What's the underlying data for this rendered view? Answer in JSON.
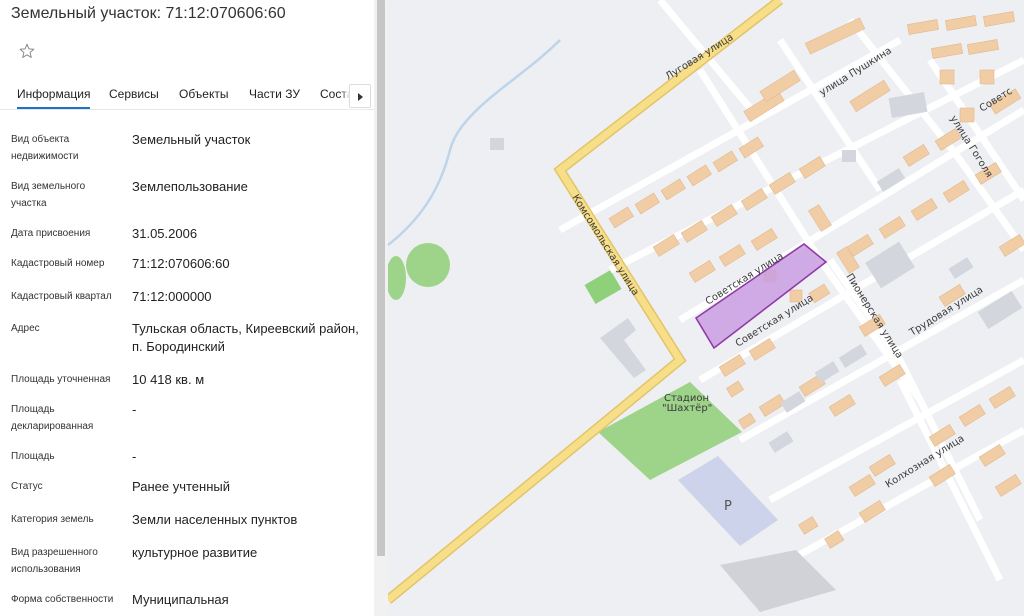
{
  "title": "Земельный участок: 71:12:070606:60",
  "tabs": [
    {
      "label": "Информация",
      "active": true
    },
    {
      "label": "Сервисы"
    },
    {
      "label": "Объекты"
    },
    {
      "label": "Части ЗУ"
    },
    {
      "label": "Состав"
    }
  ],
  "fields": [
    {
      "label": "Вид объекта недвижимости",
      "value": "Земельный участок"
    },
    {
      "label": "Вид земельного участка",
      "value": "Землепользование"
    },
    {
      "label": "Дата присвоения",
      "value": "31.05.2006"
    },
    {
      "label": "Кадастровый номер",
      "value": "71:12:070606:60"
    },
    {
      "label": "Кадастровый квартал",
      "value": "71:12:000000"
    },
    {
      "label": "Адрес",
      "value": "Тульская область, Киреевский район, п. Бородинский"
    },
    {
      "label": "Площадь уточненная",
      "value": "10 418 кв. м"
    },
    {
      "label": "Площадь декларированная",
      "value": "-"
    },
    {
      "label": "Площадь",
      "value": "-"
    },
    {
      "label": "Статус",
      "value": "Ранее учтенный"
    },
    {
      "label": "Категория земель",
      "value": "Земли населенных пунктов"
    },
    {
      "label": "Вид разрешенного использования",
      "value": "культурное развитие"
    },
    {
      "label": "Форма собственности",
      "value": "Муниципальная"
    }
  ],
  "map": {
    "streets": {
      "lugovaya": "Луговая улица",
      "komsomolskaya": "Комсомольская улица",
      "pushkina": "улица Пушкина",
      "gogolya": "улица Гоголя",
      "sovetskaya_1": "Советская улица",
      "sovetskaya_2": "Советская улица",
      "pionerskaya": "Пионерская улица",
      "trudovaya": "Трудовая улица",
      "kolkhoznaya": "Колхозная улица",
      "sovets_edge": "Советс"
    },
    "stadium_line1": "Стадион",
    "stadium_line2": "\"Шахтёр\"",
    "parking": "P"
  },
  "colors": {
    "accent": "#1a73c9",
    "road_main": "#f5dc86",
    "building": "#f1cda5",
    "green": "#9ed48a",
    "parcel_fill": "#c99de0",
    "parcel_stroke": "#8f3aa8"
  },
  "icons": {
    "star": "star-icon",
    "tab_next": "chevron-right-icon"
  }
}
